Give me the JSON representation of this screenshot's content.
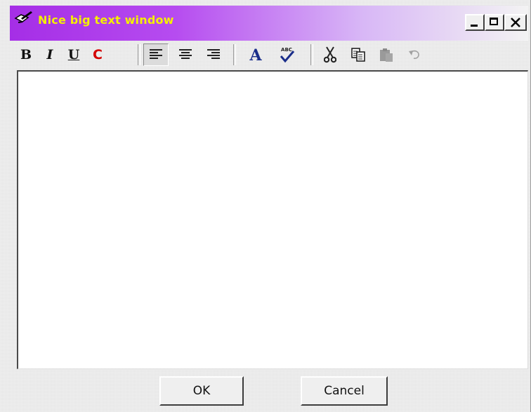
{
  "window": {
    "title": "Nice big text window",
    "title_color": "#f4f000",
    "title_gradient": [
      "#a52ee6",
      "#f3f3f3"
    ],
    "icons": {
      "app": "pen-tablet-icon",
      "minimize": "minimize-icon",
      "maximize": "maximize-icon",
      "close": "close-icon"
    }
  },
  "toolbar": {
    "bold_label": "B",
    "italic_label": "I",
    "underline_label": "U",
    "color_label": "C",
    "color_label_color": "#d40000",
    "icons": [
      "align-left-icon",
      "align-center-icon",
      "align-right-icon",
      "font-icon",
      "spellcheck-icon",
      "cut-icon",
      "copy-icon",
      "paste-icon",
      "undo-icon"
    ],
    "spellcheck_abc": "ABC",
    "active_alignment": "left"
  },
  "editor": {
    "value": ""
  },
  "buttons": {
    "ok_label": "OK",
    "cancel_label": "Cancel"
  }
}
